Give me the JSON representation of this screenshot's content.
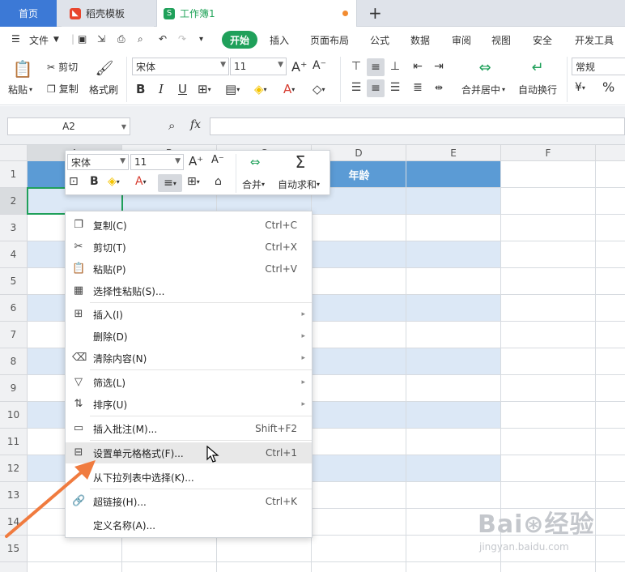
{
  "tabs": {
    "home": "首页",
    "template": "稻壳模板",
    "workbook": "工作簿1",
    "new_tab": "+"
  },
  "menubar": {
    "file": "文件",
    "items": [
      "开始",
      "插入",
      "页面布局",
      "公式",
      "数据",
      "审阅",
      "视图",
      "安全",
      "开发工具"
    ]
  },
  "ribbon": {
    "paste": "粘贴",
    "cut": "剪切",
    "copy": "复制",
    "format_painter": "格式刷",
    "font_name": "宋体",
    "font_size": "11",
    "bold": "B",
    "italic": "I",
    "underline": "U",
    "merge_center": "合并居中",
    "wrap_text": "自动换行",
    "number_format": "常规",
    "percent": "%"
  },
  "formula_bar": {
    "cell_ref": "A2",
    "fx": "fx"
  },
  "columns": [
    "A",
    "B",
    "C",
    "D",
    "E",
    "F"
  ],
  "rows": [
    "1",
    "2",
    "3",
    "4",
    "5",
    "6",
    "7",
    "8",
    "9",
    "10",
    "11",
    "12",
    "13",
    "14",
    "15"
  ],
  "header_row": {
    "d1": "年龄"
  },
  "mini_toolbar": {
    "font_name": "宋体",
    "font_size": "11",
    "bold": "B",
    "merge": "合并",
    "autosum": "自动求和"
  },
  "context_menu": [
    {
      "label": "复制(C)",
      "shortcut": "Ctrl+C",
      "icon": "copy-icon"
    },
    {
      "label": "剪切(T)",
      "shortcut": "Ctrl+X",
      "icon": "scissors-icon"
    },
    {
      "label": "粘贴(P)",
      "shortcut": "Ctrl+V",
      "icon": "paste-icon"
    },
    {
      "label": "选择性粘贴(S)...",
      "shortcut": "",
      "icon": "paste-special-icon"
    },
    {
      "label": "插入(I)",
      "shortcut": "",
      "icon": "insert-icon",
      "submenu": true
    },
    {
      "label": "删除(D)",
      "shortcut": "",
      "icon": "",
      "submenu": true
    },
    {
      "label": "清除内容(N)",
      "shortcut": "",
      "icon": "eraser-icon",
      "submenu": true
    },
    {
      "label": "筛选(L)",
      "shortcut": "",
      "icon": "filter-icon",
      "submenu": true
    },
    {
      "label": "排序(U)",
      "shortcut": "",
      "icon": "sort-icon",
      "submenu": true
    },
    {
      "label": "插入批注(M)...",
      "shortcut": "Shift+F2",
      "icon": "comment-icon"
    },
    {
      "label": "设置单元格格式(F)...",
      "shortcut": "Ctrl+1",
      "icon": "format-cells-icon",
      "highlighted": true
    },
    {
      "label": "从下拉列表中选择(K)...",
      "shortcut": "",
      "icon": ""
    },
    {
      "label": "超链接(H)...",
      "shortcut": "Ctrl+K",
      "icon": "link-icon"
    },
    {
      "label": "定义名称(A)...",
      "shortcut": "",
      "icon": ""
    }
  ],
  "watermark": {
    "brand": "Bai⊛经验",
    "url": "jingyan.baidu.com"
  },
  "colors": {
    "accent_green": "#1fa05a",
    "home_tab": "#3c79d6",
    "header_fill": "#5b9bd5",
    "band_fill": "#dce8f6",
    "arrow": "#f07b3f"
  }
}
